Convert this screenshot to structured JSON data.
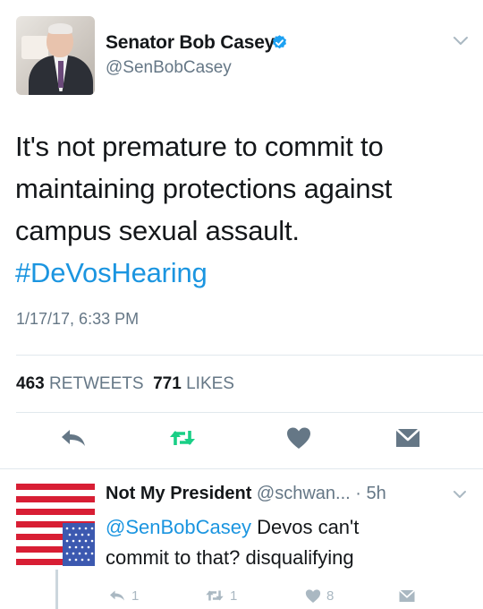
{
  "tweet": {
    "author_name": "Senator Bob Casey",
    "author_handle": "@SenBobCasey",
    "verified_icon": "verified-badge-icon",
    "text_lines": [
      "It's not premature to commit to",
      "maintaining protections against",
      "campus sexual assault."
    ],
    "hashtag": "#DeVosHearing",
    "timestamp": "1/17/17, 6:33 PM",
    "retweets_count": "463",
    "retweets_label": "RETWEETS",
    "likes_count": "771",
    "likes_label": "LIKES",
    "actions": [
      "reply-icon",
      "retweet-icon",
      "like-heart-icon",
      "direct-message-icon"
    ]
  },
  "reply": {
    "author_name": "Not My President",
    "author_handle": "@schwan...",
    "time": "· 5h",
    "mention": "@SenBobCasey",
    "text_after_mention": " Devos can't",
    "text_line2": "commit to that?  disqualifying",
    "reply_count": "1",
    "retweet_count": "1",
    "like_count": "8"
  },
  "colors": {
    "link_blue": "#1b95e0",
    "retweet_green": "#19cf86",
    "icon_gray": "#657786",
    "light_gray": "#aab8c2",
    "flag_red": "#d81e34",
    "flag_blue": "#3c59b0"
  }
}
